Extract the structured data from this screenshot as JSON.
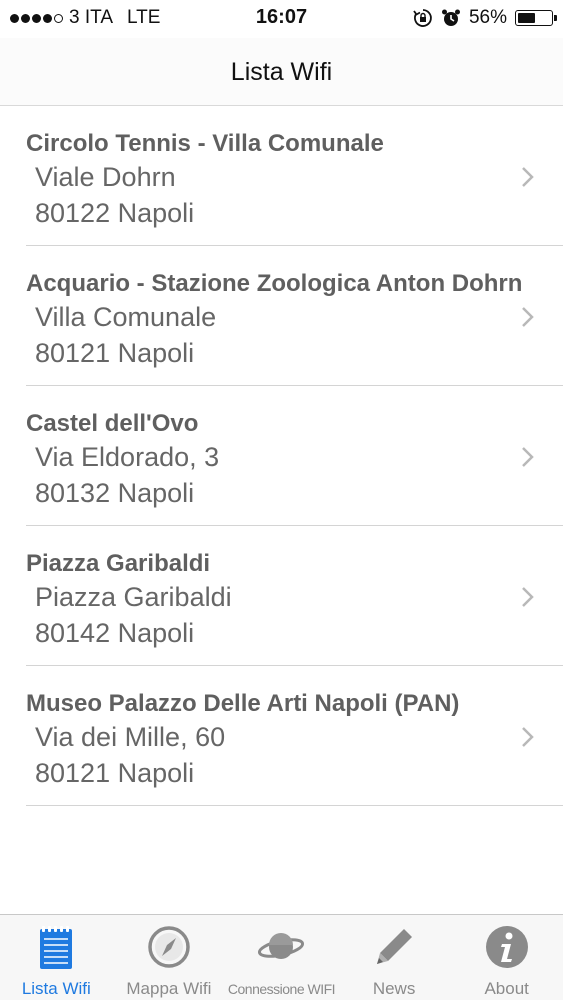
{
  "status_bar": {
    "carrier": "3 ITA",
    "network": "LTE",
    "time": "16:07",
    "battery": "56%",
    "battery_level": 0.56
  },
  "nav": {
    "title": "Lista Wifi"
  },
  "list": [
    {
      "name": "Circolo Tennis - Villa Comunale",
      "street": "Viale Dohrn",
      "city": "80122 Napoli"
    },
    {
      "name": "Acquario - Stazione Zoologica Anton Dohrn",
      "street": "Villa Comunale",
      "city": "80121 Napoli"
    },
    {
      "name": "Castel dell'Ovo",
      "street": "Via Eldorado, 3",
      "city": "80132 Napoli"
    },
    {
      "name": "Piazza Garibaldi",
      "street": "Piazza Garibaldi",
      "city": "80142 Napoli"
    },
    {
      "name": "Museo Palazzo Delle Arti Napoli (PAN)",
      "street": "Via dei Mille, 60",
      "city": "80121 Napoli"
    }
  ],
  "tabs": [
    {
      "label": "Lista Wifi",
      "icon": "notepad-icon"
    },
    {
      "label": "Mappa Wifi",
      "icon": "compass-icon"
    },
    {
      "label": "Connessione WIFI",
      "icon": "planet-icon"
    },
    {
      "label": "News",
      "icon": "pencil-icon"
    },
    {
      "label": "About",
      "icon": "info-icon"
    }
  ],
  "colors": {
    "accent": "#1f7ae0",
    "inactive": "#8a8a8a"
  }
}
